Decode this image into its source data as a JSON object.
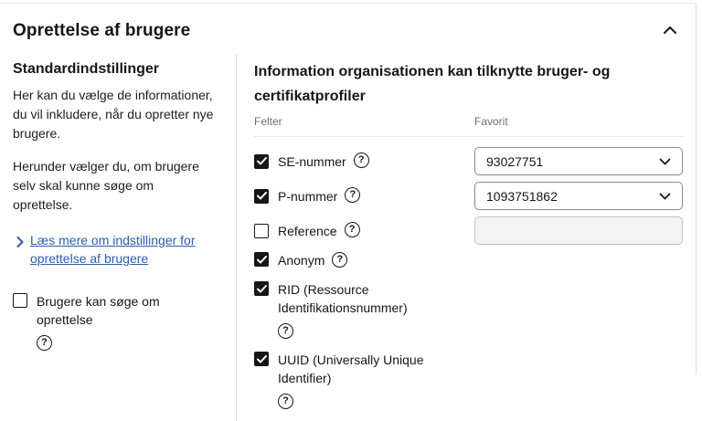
{
  "panel": {
    "title": "Oprettelse af brugere"
  },
  "sidebar": {
    "heading": "Standardindstillinger",
    "paragraph1": "Her kan du vælge de informationer, du vil inkludere, når du opretter nye brugere.",
    "paragraph2": "Herunder vælger du, om brugere selv skal kunne søge om oprettelse.",
    "link_label": "Læs mere om indstillinger for opret­telse af brugere",
    "checkbox": {
      "label": "Brugere kan søge om oprettelse",
      "checked": false
    }
  },
  "main": {
    "heading": "Information organisationen kan tilknytte bruger- og certifikatprofiler",
    "columns": {
      "fields": "Felter",
      "favorite": "Favorit"
    },
    "rows": [
      {
        "label": "SE-nummer",
        "checked": true,
        "control": "select",
        "value": "93027751"
      },
      {
        "label": "P-nummer",
        "checked": true,
        "control": "select",
        "value": "1093751862"
      },
      {
        "label": "Reference",
        "checked": false,
        "control": "input-disabled",
        "value": ""
      },
      {
        "label": "Anonym",
        "checked": true,
        "control": "none",
        "value": ""
      },
      {
        "label": "RID (Ressource Identifikationsnum­mer)",
        "checked": true,
        "control": "none",
        "value": ""
      },
      {
        "label": "UUID (Universally Unique Identifier)",
        "checked": true,
        "control": "none",
        "value": ""
      }
    ]
  },
  "colors": {
    "text": "#161616",
    "muted_label": "#6f6f6f",
    "link_blue": "#2a5db0",
    "divider": "#dcdcdc",
    "control_border": "#8d8d8d",
    "disabled_bg": "#f3f3f3",
    "checkbox_checked": "#161616"
  }
}
